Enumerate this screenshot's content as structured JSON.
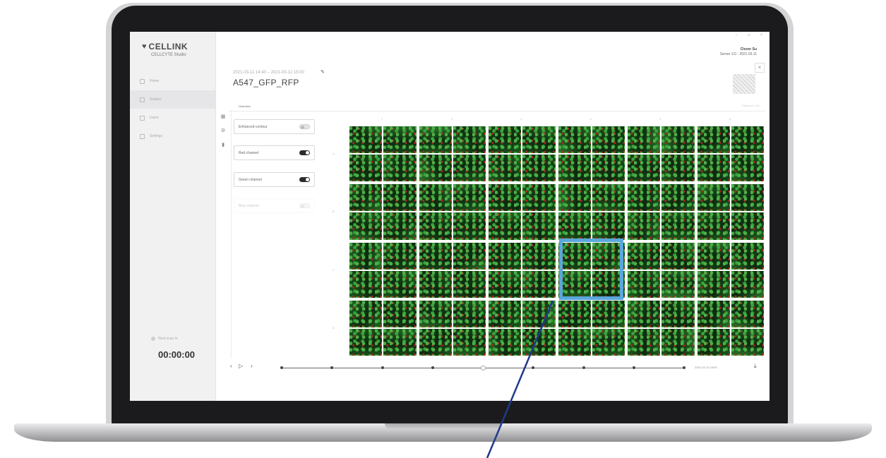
{
  "app": {
    "brand": "CELLINK",
    "sub_brand": "CELLCYTE Studio"
  },
  "window": {
    "controls": [
      "–",
      "▭",
      "×"
    ]
  },
  "user": {
    "name": "Clover Su",
    "detail": "Server 3.0 · 2021.03.11"
  },
  "sidebar": {
    "items": [
      {
        "label": "Home",
        "icon": "home-icon"
      },
      {
        "label": "Studies",
        "icon": "studies-icon",
        "active": true
      },
      {
        "label": "Users",
        "icon": "users-icon"
      },
      {
        "label": "Settings",
        "icon": "settings-icon"
      }
    ],
    "next_scan_label": "Next scan in",
    "timer": "00:00:00"
  },
  "experiment": {
    "date_range": "2021-03-11 14:40 – 2021-03-12 15:00",
    "title": "A547_GFP_RFP",
    "tab": "Overview",
    "info": "Objective: 10x"
  },
  "tools": [
    "grid-view-icon",
    "analysis-icon",
    "chart-icon"
  ],
  "channel_controls": [
    {
      "label": "Enhanced contour",
      "state": "off"
    },
    {
      "label": "Red channel",
      "state": "on"
    },
    {
      "label": "Green channel",
      "state": "on"
    },
    {
      "label": "Blue channel",
      "state": "off"
    }
  ],
  "plate": {
    "columns": [
      "1",
      "2",
      "3",
      "4",
      "5",
      "6"
    ],
    "rows": [
      "A",
      "B",
      "C",
      "D"
    ],
    "sub_cells_per_well": 4
  },
  "timeline": {
    "points": 9,
    "current_fraction": 0.5,
    "end_label": "2021-03-12 15:00",
    "prev": "‹",
    "play": "▷",
    "next": "›"
  },
  "colors": {
    "highlight": "#5aa7dc",
    "callout_line": "#1f3a8a",
    "green_channel": "#3aa23b",
    "red_channel": "#c0301f"
  }
}
